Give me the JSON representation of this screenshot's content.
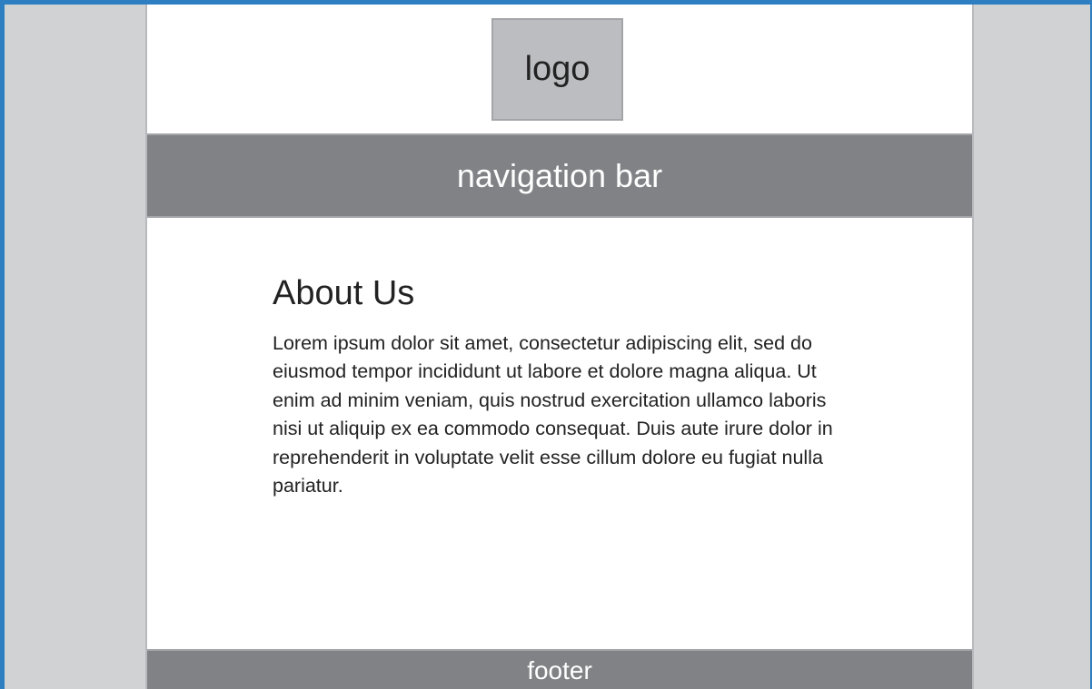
{
  "logo": {
    "label": "logo"
  },
  "navigation": {
    "label": "navigation bar"
  },
  "main": {
    "heading": "About Us",
    "body": "Lorem ipsum dolor sit amet, consectetur adipiscing elit, sed do eiusmod tempor incididunt ut labore et dolore magna aliqua. Ut enim ad minim veniam, quis nostrud exercitation ullamco laboris nisi ut aliquip ex ea commodo consequat. Duis aute irure dolor in reprehenderit in voluptate velit esse cillum dolore eu fugiat nulla pariatur."
  },
  "footer": {
    "label": "footer"
  },
  "colors": {
    "frame_border": "#2d7fc1",
    "side_background": "#d1d2d4",
    "bar": "#818286",
    "logo_box": "#bcbdc1"
  }
}
